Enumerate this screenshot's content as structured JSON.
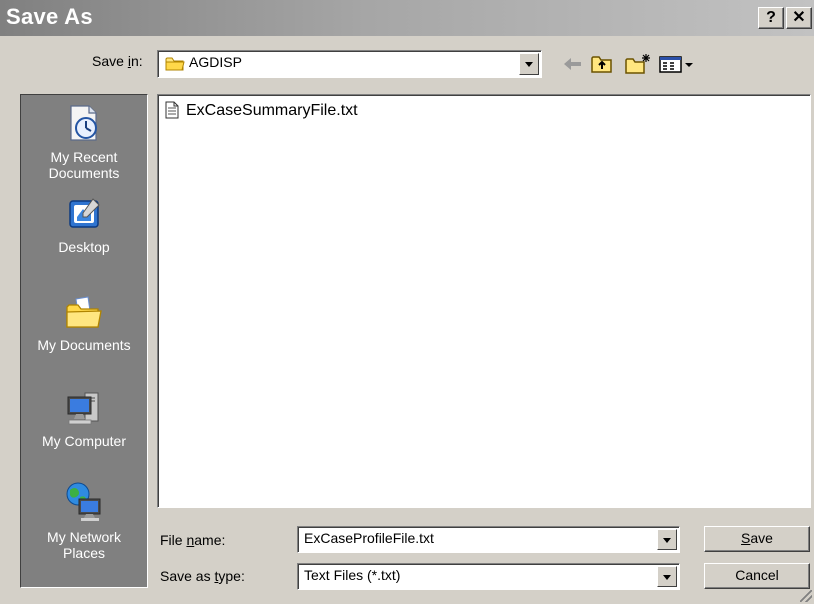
{
  "window": {
    "title": "Save As",
    "help_glyph": "?",
    "close_glyph": "✕"
  },
  "save_in": {
    "label_pre": "Save ",
    "label_accel": "i",
    "label_post": "n:",
    "value": "AGDISP",
    "icon": "folder-icon"
  },
  "toolbar": {
    "icons": [
      "back-arrow-icon",
      "up-one-level-icon",
      "new-folder-icon",
      "view-menu-icon"
    ]
  },
  "places": [
    {
      "label_line1": "My Recent",
      "label_line2": "Documents",
      "icon": "recent-documents-icon"
    },
    {
      "label_line1": "Desktop",
      "label_line2": "",
      "icon": "desktop-icon"
    },
    {
      "label_line1": "My Documents",
      "label_line2": "",
      "icon": "my-documents-icon"
    },
    {
      "label_line1": "My Computer",
      "label_line2": "",
      "icon": "my-computer-icon"
    },
    {
      "label_line1": "My Network",
      "label_line2": "Places",
      "icon": "network-places-icon"
    }
  ],
  "files": [
    {
      "name": "ExCaseSummaryFile.txt",
      "icon": "text-file-icon"
    }
  ],
  "file_name": {
    "label_pre": "File ",
    "label_accel": "n",
    "label_post": "ame:",
    "value": "ExCaseProfileFile.txt"
  },
  "save_as_type": {
    "label_pre": "Save as ",
    "label_accel": "t",
    "label_post": "ype:",
    "value": "Text Files (*.txt)"
  },
  "buttons": {
    "save_accel": "S",
    "save_rest": "ave",
    "cancel": "Cancel"
  },
  "colors": {
    "dialog_face": "#d4d0c8",
    "places_bar": "#808080",
    "title_gradient_start": "#808080",
    "title_gradient_end": "#c2c2c2"
  }
}
